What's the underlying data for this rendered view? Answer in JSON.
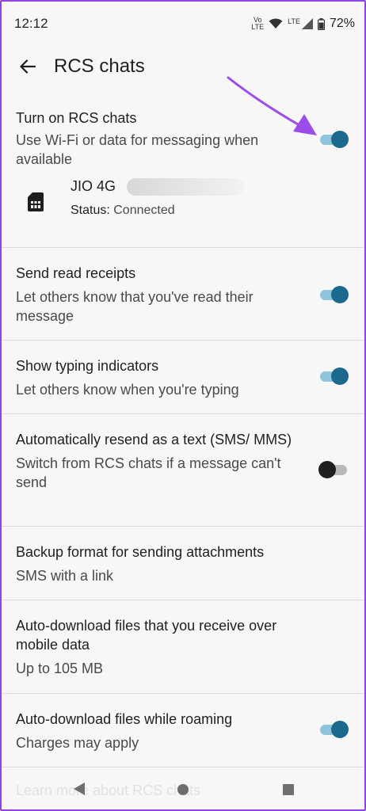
{
  "status_bar": {
    "time": "12:12",
    "volte_top": "Vo",
    "volte_bottom": "LTE",
    "lte_label": "LTE",
    "battery": "72%"
  },
  "app_bar": {
    "title": "RCS chats",
    "back_icon": "arrow-left-icon"
  },
  "rcs_toggle": {
    "title": "Turn on RCS chats",
    "subtitle": "Use Wi-Fi or data for messaging when available",
    "enabled": true
  },
  "sim": {
    "name": "JIO 4G",
    "status_label": "Status: ",
    "status_value": "Connected"
  },
  "settings": [
    {
      "title": "Send read receipts",
      "subtitle": "Let others know that you've read their message",
      "enabled": true
    },
    {
      "title": "Show typing indicators",
      "subtitle": "Let others know when you're typing",
      "enabled": true
    },
    {
      "title": "Automatically resend as a text (SMS/ MMS)",
      "subtitle": "Switch from RCS chats if a message can't send",
      "enabled": false
    },
    {
      "title": "Backup format for sending attachments",
      "subtitle": "SMS with a link"
    },
    {
      "title": "Auto-download files that you receive over mobile data",
      "subtitle": "Up to 105 MB"
    },
    {
      "title": "Auto-download files while roaming",
      "subtitle": "Charges may apply",
      "enabled": true
    }
  ],
  "footer_link": "Learn more about RCS chats",
  "colors": {
    "accent": "#1b6a8e",
    "accent_track": "#8ec5dc",
    "annotation_arrow": "#9b4dea",
    "frame_border": "#8e44e4"
  }
}
